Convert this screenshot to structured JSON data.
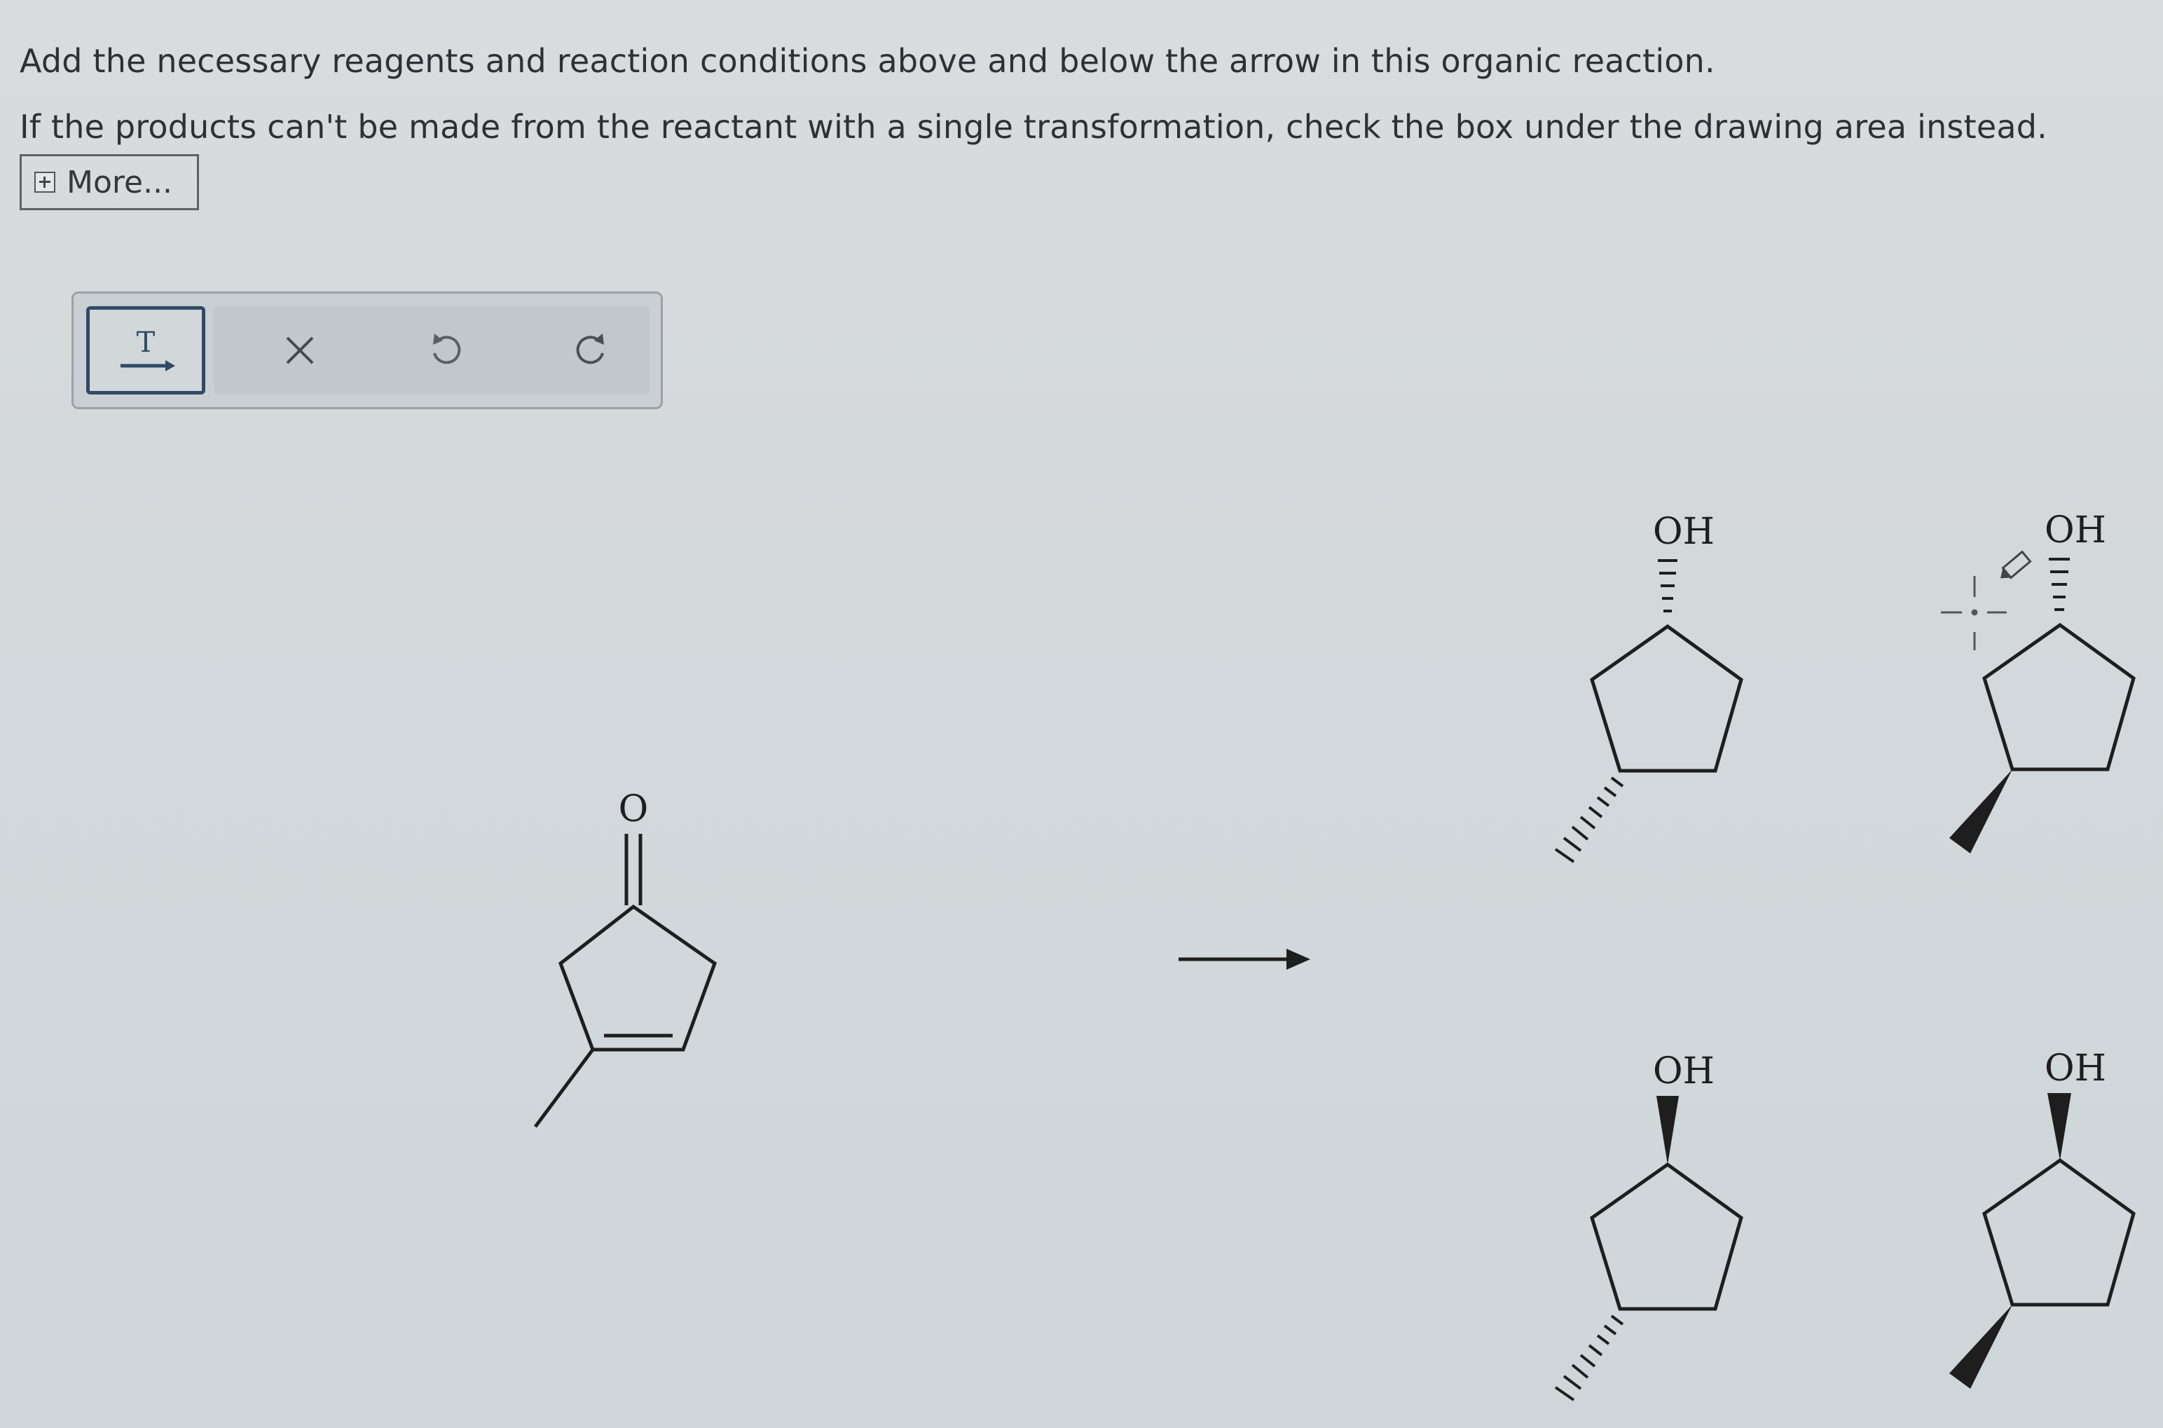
{
  "instructions": {
    "line1": "Add the necessary reagents and reaction conditions above and below the arrow in this organic reaction.",
    "line2": "If the products can't be made from the reactant with a single transformation, check the box under the drawing area instead."
  },
  "more_button": {
    "label": "More..."
  },
  "toolbar": {
    "tools": [
      {
        "name": "text-arrow-tool",
        "icon": "text-arrow-icon",
        "glyph": "T"
      },
      {
        "name": "clear-tool",
        "icon": "close-icon"
      },
      {
        "name": "undo-tool",
        "icon": "undo-icon"
      },
      {
        "name": "redo-tool",
        "icon": "redo-icon"
      }
    ]
  },
  "reactant": {
    "atom_label": "O"
  },
  "products": [
    {
      "atom_label": "OH"
    },
    {
      "atom_label": "OH"
    },
    {
      "atom_label": "OH"
    },
    {
      "atom_label": "OH"
    }
  ],
  "colors": {
    "background": "#d5d9dc",
    "text": "#2d3136",
    "toolbar_border": "#9ba1a6",
    "active_tool_border": "#2f4a66",
    "bond": "#1e1e1e"
  }
}
